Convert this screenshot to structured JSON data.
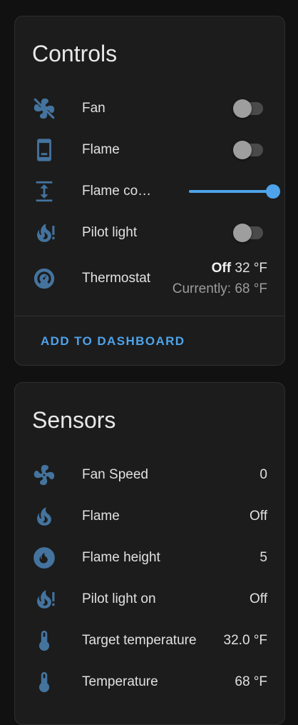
{
  "controls": {
    "title": "Controls",
    "fan": {
      "label": "Fan",
      "icon": "fan-icon",
      "state": "off"
    },
    "flame": {
      "label": "Flame",
      "icon": "phone-icon",
      "state": "off"
    },
    "flame_control": {
      "label": "Flame co…",
      "icon": "arrow-expand-vertical-icon",
      "level_percent": 100
    },
    "pilot_light": {
      "label": "Pilot light",
      "icon": "fire-alert-icon",
      "state": "off"
    },
    "thermostat": {
      "label": "Thermostat",
      "icon": "thermostat-icon",
      "mode": "Off",
      "setpoint": "32 °F",
      "current": "Currently: 68 °F"
    },
    "add_to_dashboard": "ADD TO DASHBOARD"
  },
  "sensors": {
    "title": "Sensors",
    "items": [
      {
        "label": "Fan Speed",
        "value": "0",
        "icon": "fan-icon"
      },
      {
        "label": "Flame",
        "value": "Off",
        "icon": "fire-icon"
      },
      {
        "label": "Flame height",
        "value": "5",
        "icon": "fire-circle-icon"
      },
      {
        "label": "Pilot light on",
        "value": "Off",
        "icon": "fire-alert-icon"
      },
      {
        "label": "Target temperature",
        "value": "32.0 °F",
        "icon": "thermometer-icon"
      },
      {
        "label": "Temperature",
        "value": "68 °F",
        "icon": "thermometer-icon"
      }
    ]
  },
  "colors": {
    "background": "#111111",
    "card": "#1c1c1c",
    "icon": "#44739e",
    "accent": "#4ea3ea",
    "text": "#e1e1e1",
    "secondary_text": "#9b9b9b"
  }
}
